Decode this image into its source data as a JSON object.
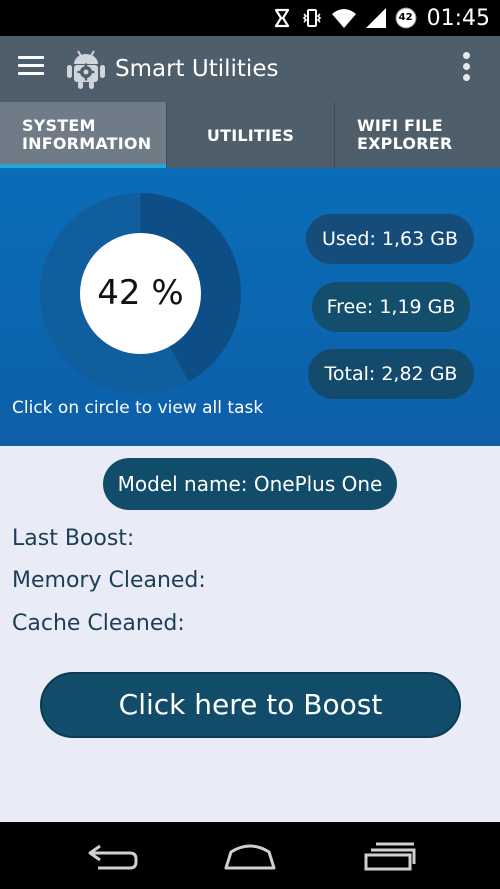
{
  "status_bar": {
    "battery_level": "42",
    "time": "01:45"
  },
  "app_bar": {
    "title": "Smart Utilities",
    "menu_icon": "hamburger-menu-icon",
    "logo_icon": "android-gear-icon",
    "overflow_icon": "more-vert-icon"
  },
  "tabs": [
    {
      "line1": "SYSTEM",
      "line2": "INFORMATION",
      "active": true
    },
    {
      "label": "UTILITIES",
      "active": false
    },
    {
      "line1": "WIFI FILE",
      "line2": "EXPLORER",
      "active": false
    }
  ],
  "memory": {
    "percent_label": "42 %",
    "percent_value": 42,
    "hint": "Click on circle to view all task",
    "used": "Used: 1,63 GB",
    "free": "Free: 1,19 GB",
    "total": "Total: 2,82 GB"
  },
  "device": {
    "model": "Model name: OnePlus One",
    "last_boost": "Last Boost:",
    "memory_cleaned": "Memory Cleaned:",
    "cache_cleaned": "Cache Cleaned:"
  },
  "boost_button": "Click here to Boost",
  "colors": {
    "app_bar": "#4f5e6b",
    "accent": "#2aa3d6",
    "panel_blue": "#0a6db9",
    "donut_dark": "#0d4e87",
    "donut_light": "#115e9e",
    "pill_dark": "#114d6a",
    "main_bg": "#e9ebf6"
  }
}
